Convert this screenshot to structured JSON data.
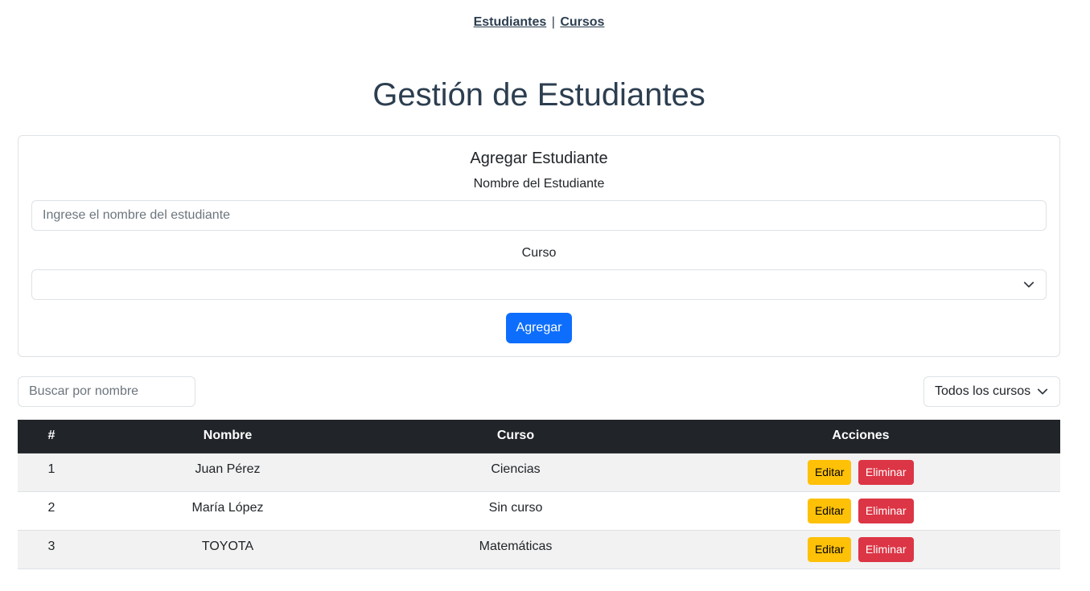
{
  "nav": {
    "students_link": "Estudiantes",
    "separator": "|",
    "courses_link": "Cursos"
  },
  "page_title": "Gestión de Estudiantes",
  "add_form": {
    "title": "Agregar Estudiante",
    "name_label": "Nombre del Estudiante",
    "name_placeholder": "Ingrese el nombre del estudiante",
    "course_label": "Curso",
    "course_value": "",
    "submit_label": "Agregar"
  },
  "filters": {
    "search_placeholder": "Buscar por nombre",
    "course_filter_value": "Todos los cursos"
  },
  "table": {
    "headers": [
      "#",
      "Nombre",
      "Curso",
      "Acciones"
    ],
    "rows": [
      {
        "id": "1",
        "name": "Juan Pérez",
        "course": "Ciencias",
        "edit": "Editar",
        "delete": "Eliminar"
      },
      {
        "id": "2",
        "name": "María López",
        "course": "Sin curso",
        "edit": "Editar",
        "delete": "Eliminar"
      },
      {
        "id": "3",
        "name": "TOYOTA",
        "course": "Matemáticas",
        "edit": "Editar",
        "delete": "Eliminar"
      }
    ]
  },
  "colors": {
    "primary": "#0d6efd",
    "warning": "#ffc107",
    "danger": "#dc3545",
    "table_header": "#212529",
    "title": "#2c3e50"
  }
}
